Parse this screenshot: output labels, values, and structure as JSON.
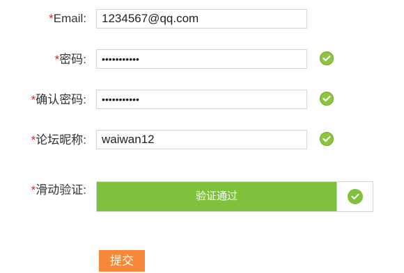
{
  "form": {
    "email": {
      "required_mark": "*",
      "label": "Email:",
      "value": "1234567@qq.com"
    },
    "password": {
      "required_mark": "*",
      "label": "密码:",
      "value": "•••••••••••",
      "valid": true
    },
    "confirm_password": {
      "required_mark": "*",
      "label": "确认密码:",
      "value": "•••••••••••",
      "valid": true
    },
    "nickname": {
      "required_mark": "*",
      "label": "论坛昵称:",
      "value": "waiwan12",
      "valid": true
    },
    "slider_captcha": {
      "required_mark": "*",
      "label": "滑动验证:",
      "status_text": "验证通过",
      "progress": 1.0
    },
    "submit_label": "提交"
  },
  "icons": {
    "valid": "check-circle-icon",
    "slider_handle": "check-circle-icon"
  },
  "colors": {
    "required": "#e02020",
    "valid_check": "#8cc63f",
    "slider_fill": "#7dc13c",
    "submit_bg": "#f7883a",
    "border": "#d6d6d6"
  }
}
